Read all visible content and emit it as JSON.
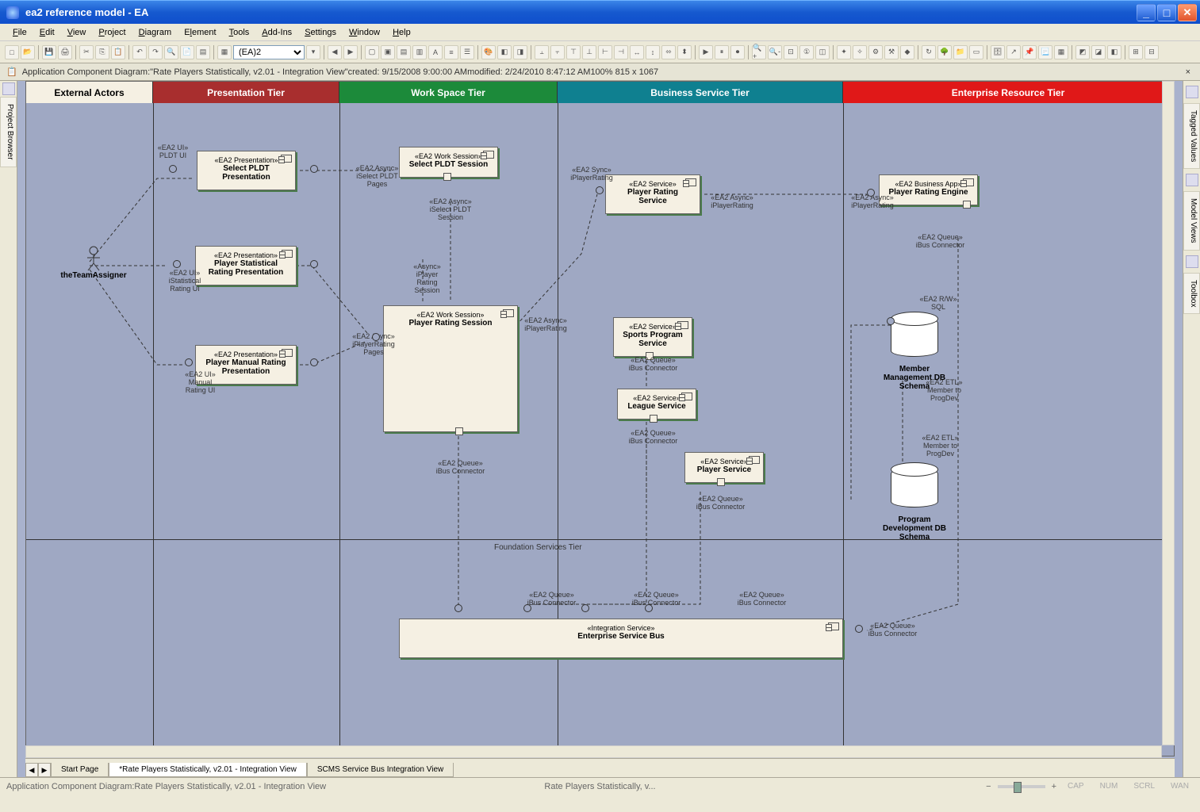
{
  "window": {
    "title": "ea2 reference model - EA"
  },
  "menu": [
    "File",
    "Edit",
    "View",
    "Project",
    "Diagram",
    "Element",
    "Tools",
    "Add-Ins",
    "Settings",
    "Window",
    "Help"
  ],
  "toolbar": {
    "combo": "(EA)2"
  },
  "infobar": {
    "prefix": "Application Component Diagram: ",
    "name": "\"Rate Players Statistically, v2.01 - Integration View\"",
    "created": "  created: 9/15/2008 9:00:00 AM",
    "modified": "  modified: 2/24/2010 8:47:12 AM",
    "zoom": "   100%   815 x 1067"
  },
  "tiers": {
    "external": "External Actors",
    "presentation": "Presentation Tier",
    "workspace": "Work Space Tier",
    "business": "Business Service Tier",
    "enterprise": "Enterprise Resource Tier",
    "foundation": "Foundation Services Tier"
  },
  "actor": {
    "name": "theTeamAssigner"
  },
  "components": {
    "selectPldtPres": {
      "stereo": "«EA2 Presentation»",
      "name": "Select PLDT Presentation"
    },
    "statRatingPres": {
      "stereo": "«EA2 Presentation»",
      "name": "Player Statistical Rating Presentation"
    },
    "manualRatingPres": {
      "stereo": "«EA2 Presentation»",
      "name": "Player Manual Rating Presentation"
    },
    "selectPldtSession": {
      "stereo": "«EA2 Work Session»",
      "name": "Select PLDT Session"
    },
    "playerRatingSession": {
      "stereo": "«EA2 Work Session»",
      "name": "Player Rating Session"
    },
    "playerRatingService": {
      "stereo": "«EA2 Service»",
      "name": "Player Rating Service"
    },
    "sportsProgramService": {
      "stereo": "«EA2 Service»",
      "name": "Sports Program Service"
    },
    "leagueService": {
      "stereo": "«EA2 Service»",
      "name": "League Service"
    },
    "playerService": {
      "stereo": "«EA2 Service»",
      "name": "Player Service"
    },
    "playerRatingEngine": {
      "stereo": "«EA2 Business App»",
      "name": "Player Rating Engine"
    },
    "esb": {
      "stereo": "«Integration Service»",
      "name": "Enterprise Service Bus"
    }
  },
  "databases": {
    "memberMgmt": {
      "name": "Member Management DB Schema"
    },
    "progDev": {
      "name": "Program Development DB Schema"
    }
  },
  "interfaces": {
    "pldtUi": "«EA2 UI»\nPLDT UI",
    "statRatingUi": "«EA2 UI»\niStatistical Rating UI",
    "manualRatingUi": "«EA2 UI»\nManual Rating UI",
    "iSelectPldtPages": "«EA2 Async»\niSelect PLDT Pages",
    "iSelectPldtSession": "«EA2 Async»\niSelect PLDT Session",
    "iPlayerRatingPages": "«EA2 Async»\niPlayerRating Pages",
    "asyncIPlayerRatingSession": "«Async»\niPlayer Rating Session",
    "iPlayerRatingAsync": "«EA2 Async»\niPlayerRating",
    "iPlayerRatingSync": "«EA2 Sync»\niPlayerRating",
    "iPlayerRatingAsync2": "«EA2 Async»\niPlayerRating",
    "iPlayerRatingAsync3": "«EA2 Async»\niPlayerRating",
    "iBusConnector": "«EA2 Queue»\niBus Connector",
    "rwSql": "«EA2 R/W»\nSQL",
    "etlMemberToProgDev": "«EA2 ETL»\nMember to ProgDev"
  },
  "sidetabs": {
    "left": "Project Browser",
    "right": [
      "Tagged Values",
      "Model Views",
      "Toolbox"
    ]
  },
  "tabs": {
    "start": "Start Page",
    "active": "*Rate Players Statistically, v2.01 - Integration View",
    "scms": "SCMS Service Bus Integration View"
  },
  "statusbar": {
    "left": "Application Component Diagram:Rate Players Statistically, v2.01 - Integration View",
    "center": "Rate Players Statistically, v...",
    "indicators": [
      "CAP",
      "NUM",
      "SCRL",
      "WAN"
    ]
  }
}
